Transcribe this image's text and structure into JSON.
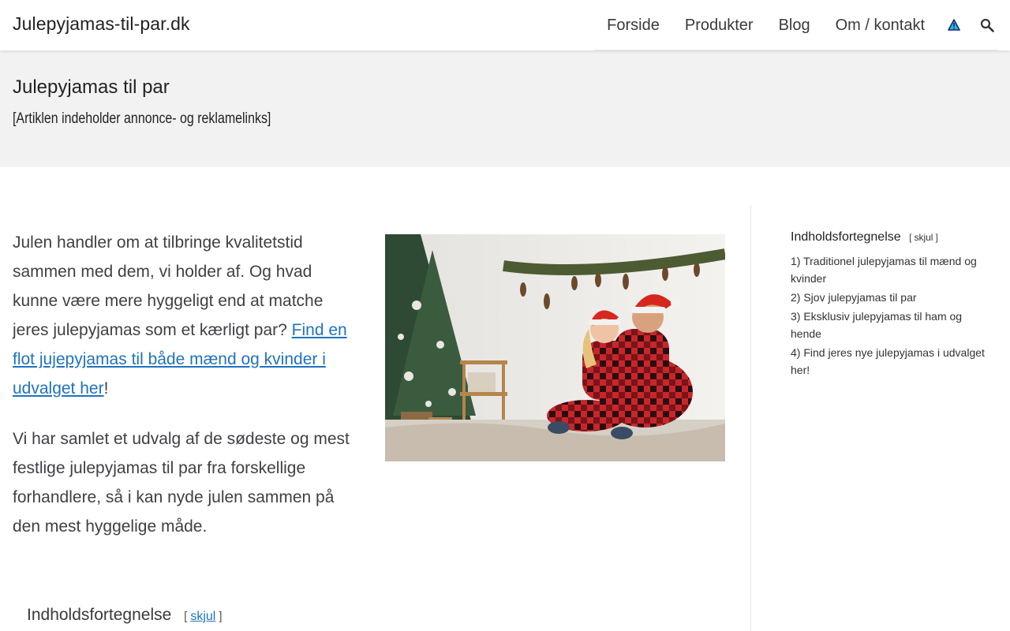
{
  "header": {
    "site_title": "Julepyjamas-til-par.dk",
    "nav": [
      {
        "label": "Forside"
      },
      {
        "label": "Produkter"
      },
      {
        "label": "Blog"
      },
      {
        "label": "Om / kontakt"
      }
    ],
    "icons": [
      "warning-triangle-icon",
      "search-icon"
    ]
  },
  "hero": {
    "title": "Julepyjamas til par",
    "notice": "[Artiklen indeholder annonce- og reklamelinks]"
  },
  "article": {
    "p1_text": "Julen handler om at tilbringe kvalitetstid sammen med dem, vi holder af. Og hvad kunne være mere hyggeligt end at matche jeres julepyjamas som et kærligt par? ",
    "p1_link": "Find en flot jujepyjamas til både mænd og kvinder i udvalget her",
    "p1_end": "!",
    "p2_text": "Vi har samlet et udvalg af de sødeste og mest festlige julepyjamas til par fra forskellige forhandlere, så i kan nyde julen sammen på den mest hyggelige måde.",
    "toc_title": "Indholdsfortegnelse",
    "toc_toggle": "skjul"
  },
  "sidebar": {
    "toc_title": "Indholdsfortegnelse",
    "toc_toggle": "skjul",
    "items": [
      {
        "num": "1)",
        "label": "Traditionel julepyjamas til mænd og kvinder"
      },
      {
        "num": "2)",
        "label": "Sjov julepyjamas til par"
      },
      {
        "num": "3)",
        "label": "Eksklusiv julepyjamas til ham og hende"
      },
      {
        "num": "4)",
        "label": "Find jeres nye julepyjamas i udvalget her!"
      }
    ]
  },
  "colors": {
    "link": "#1e73be",
    "hero_bg": "#f2f2f2",
    "text": "#3a3a3a"
  }
}
